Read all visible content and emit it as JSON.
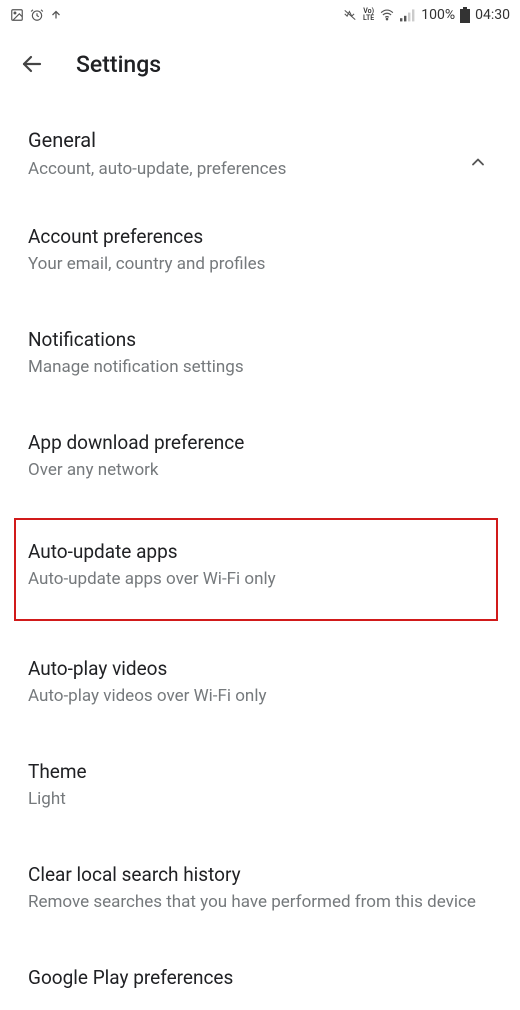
{
  "statusbar": {
    "battery_pct": "100%",
    "time": "04:30",
    "icons": {
      "image": "image-icon",
      "alarm": "alarm-icon",
      "upload": "upload-icon",
      "vibrate": "vibrate-icon",
      "volte": "VoLTE",
      "wifi": "wifi-icon",
      "signal": "signal-icon",
      "battery": "battery-icon"
    }
  },
  "appbar": {
    "back": "back-icon",
    "title": "Settings"
  },
  "section": {
    "title": "General",
    "subtitle": "Account, auto-update, preferences",
    "expand": "chevron-up"
  },
  "items": [
    {
      "title": "Account preferences",
      "subtitle": "Your email, country and profiles"
    },
    {
      "title": "Notifications",
      "subtitle": "Manage notification settings"
    },
    {
      "title": "App download preference",
      "subtitle": "Over any network"
    },
    {
      "title": "Auto-update apps",
      "subtitle": "Auto-update apps over Wi-Fi only"
    },
    {
      "title": "Auto-play videos",
      "subtitle": "Auto-play videos over Wi-Fi only"
    },
    {
      "title": "Theme",
      "subtitle": "Light"
    },
    {
      "title": "Clear local search history",
      "subtitle": "Remove searches that you have performed from this device"
    },
    {
      "title": "Google Play preferences",
      "subtitle": ""
    }
  ]
}
